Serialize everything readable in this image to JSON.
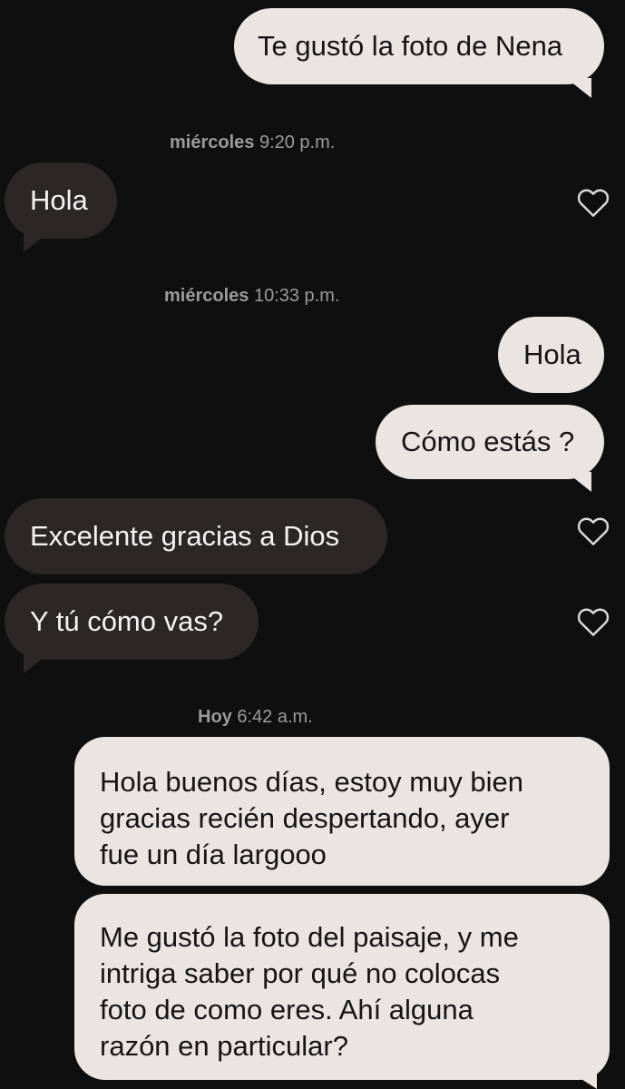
{
  "messages": {
    "m1": {
      "text": "Te gustó la foto de Nena",
      "direction": "outgoing"
    },
    "ts1": {
      "day": "miércoles",
      "time": "9:20 p.m."
    },
    "m2": {
      "text": "Hola",
      "direction": "incoming",
      "reaction_icon": "heart-outline-icon"
    },
    "ts2": {
      "day": "miércoles",
      "time": "10:33 p.m."
    },
    "m3": {
      "text": "Hola",
      "direction": "outgoing"
    },
    "m4": {
      "text": "Cómo estás ?",
      "direction": "outgoing"
    },
    "m5": {
      "text": "Excelente gracias a Dios",
      "direction": "incoming",
      "reaction_icon": "heart-outline-icon"
    },
    "m6": {
      "text": "Y tú cómo vas?",
      "direction": "incoming",
      "reaction_icon": "heart-outline-icon"
    },
    "ts3": {
      "day": "Hoy",
      "time": "6:42 a.m."
    },
    "m7": {
      "lines": [
        "Hola buenos días, estoy muy bien",
        "gracias recién despertando, ayer",
        "fue un día largooo"
      ],
      "direction": "outgoing"
    },
    "m8": {
      "lines": [
        "Me gustó la foto del paisaje, y me",
        "intriga saber por qué no colocas",
        "foto de como eres. Ahí alguna",
        "razón en particular?"
      ],
      "direction": "outgoing"
    }
  },
  "colors": {
    "background": "#0f0f0f",
    "outgoing_bubble": "#ebe5e2",
    "incoming_bubble": "#2a2726",
    "timestamp_text": "#9b9b9b"
  }
}
